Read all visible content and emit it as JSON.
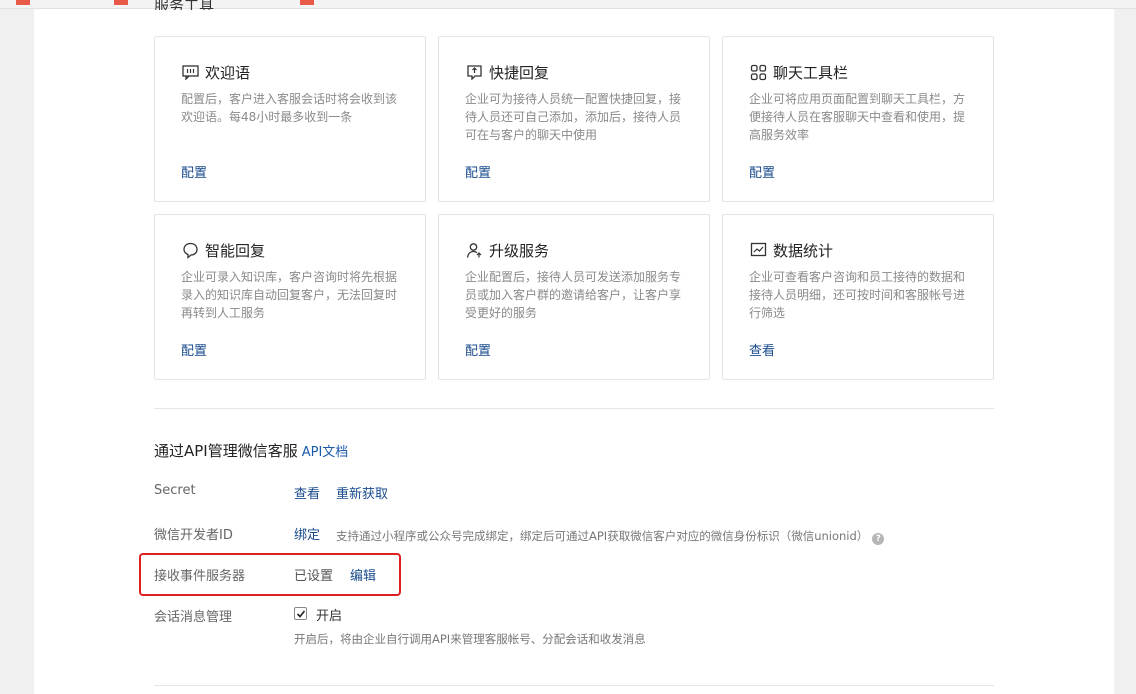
{
  "section_title": "服务工具",
  "cards": [
    {
      "icon": "chat-greeting-icon",
      "title": "欢迎语",
      "desc": "配置后，客户进入客服会话时将会收到该欢迎语。每48小时最多收到一条",
      "action": "配置"
    },
    {
      "icon": "quick-reply-icon",
      "title": "快捷回复",
      "desc": "企业可为接待人员统一配置快捷回复，接待人员还可自己添加，添加后，接待人员可在与客户的聊天中使用",
      "action": "配置"
    },
    {
      "icon": "grid-apps-icon",
      "title": "聊天工具栏",
      "desc": "企业可将应用页面配置到聊天工具栏，方便接待人员在客服聊天中查看和使用，提高服务效率",
      "action": "配置"
    },
    {
      "icon": "smart-reply-icon",
      "title": "智能回复",
      "desc": "企业可录入知识库，客户咨询时将先根据录入的知识库自动回复客户，无法回复时再转到人工服务",
      "action": "配置"
    },
    {
      "icon": "upgrade-service-icon",
      "title": "升级服务",
      "desc": "企业配置后，接待人员可发送添加服务专员或加入客户群的邀请给客户，让客户享受更好的服务",
      "action": "配置"
    },
    {
      "icon": "statistics-icon",
      "title": "数据统计",
      "desc": "企业可查看客户咨询和员工接待的数据和接待人员明细，还可按时间和客服帐号进行筛选",
      "action": "查看"
    }
  ],
  "api": {
    "title": "通过API管理微信客服",
    "doc_link": "API文档",
    "secret": {
      "label": "Secret",
      "view": "查看",
      "refresh": "重新获取"
    },
    "dev_id": {
      "label": "微信开发者ID",
      "bind": "绑定",
      "hint": "支持通过小程序或公众号完成绑定，绑定后可通过API获取微信客户对应的微信身份标识（微信unionid）"
    },
    "event_server": {
      "label": "接收事件服务器",
      "status": "已设置",
      "edit": "编辑"
    },
    "session_mgmt": {
      "label": "会话消息管理",
      "checked": true,
      "option": "开启",
      "hint": "开启后，将由企业自行调用API来管理客服帐号、分配会话和收发消息"
    }
  },
  "colors": {
    "link": "#1a4b8c",
    "highlight": "#e02020",
    "accent_top": "#e8594a"
  }
}
